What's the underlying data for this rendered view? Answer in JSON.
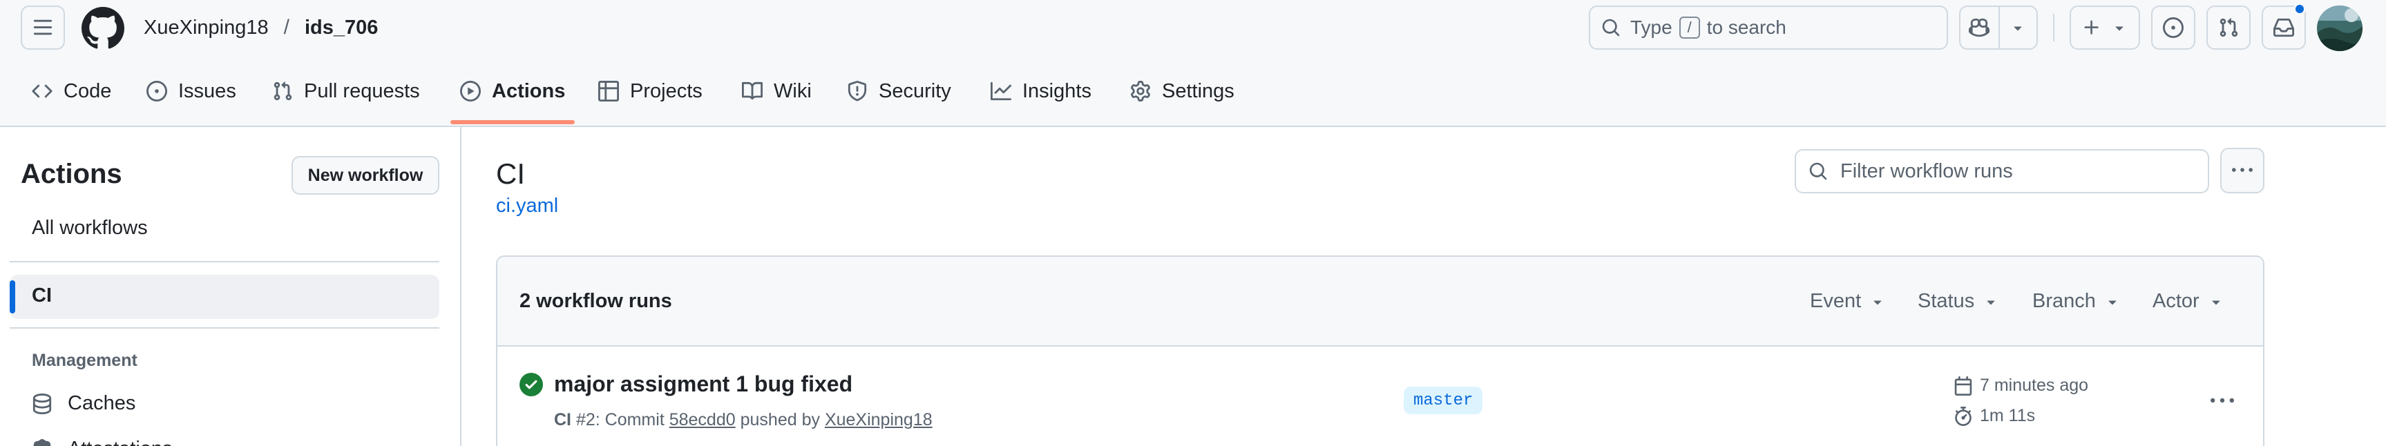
{
  "header": {
    "owner": "XueXinping18",
    "separator": "/",
    "repo": "ids_706",
    "search_prefix": "Type",
    "search_key": "/",
    "search_suffix": "to search"
  },
  "repo_nav": {
    "tabs": [
      {
        "label": "Code",
        "icon": "code-icon"
      },
      {
        "label": "Issues",
        "icon": "issue-opened-icon"
      },
      {
        "label": "Pull requests",
        "icon": "git-pull-request-icon"
      },
      {
        "label": "Actions",
        "icon": "play-icon",
        "selected": true
      },
      {
        "label": "Projects",
        "icon": "table-icon"
      },
      {
        "label": "Wiki",
        "icon": "book-icon"
      },
      {
        "label": "Security",
        "icon": "shield-icon"
      },
      {
        "label": "Insights",
        "icon": "graph-icon"
      },
      {
        "label": "Settings",
        "icon": "gear-icon"
      }
    ]
  },
  "sidebar": {
    "title": "Actions",
    "new_workflow": "New workflow",
    "all_workflows": "All workflows",
    "active_workflow": "CI",
    "management_heading": "Management",
    "caches": "Caches",
    "next_item_partial": "Attestations"
  },
  "main": {
    "workflow_title": "CI",
    "workflow_file": "ci.yaml",
    "filter_placeholder": "Filter workflow runs",
    "runs_count": "2 workflow runs",
    "filters": [
      "Event",
      "Status",
      "Branch",
      "Actor"
    ],
    "run": {
      "title": "major assigment 1 bug fixed",
      "workflow": "CI",
      "meta_number": "#2: Commit",
      "commit": "58ecdd0",
      "meta_pushed": "pushed by",
      "author": "XueXinping18",
      "branch": "master",
      "time": "7 minutes ago",
      "duration": "1m 11s",
      "status": "success"
    }
  },
  "colors": {
    "accent": "#0969da",
    "success": "#1a7f37",
    "tab_underline": "#fd8c73",
    "border": "#d1d9e0",
    "muted": "#59636e"
  }
}
